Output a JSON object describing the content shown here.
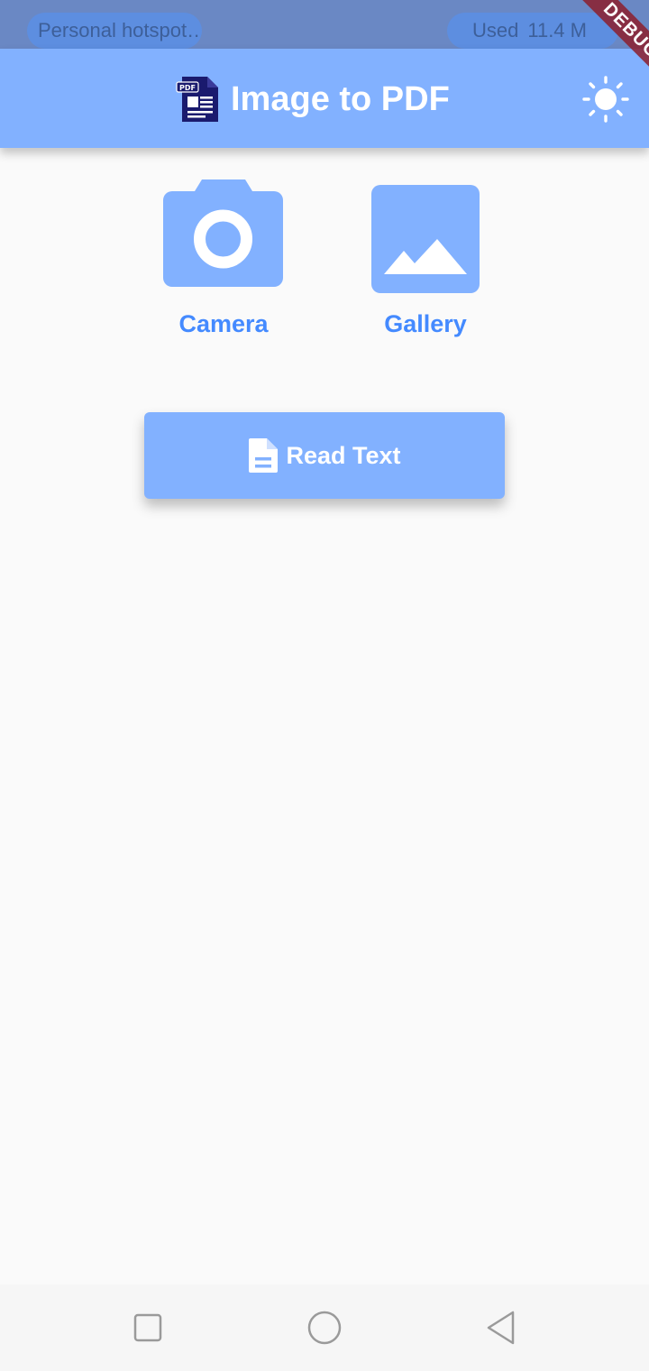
{
  "status_bar": {
    "hotspot_label": "Personal hotspot…",
    "usage_label": "Used",
    "usage_value": "11.4 M"
  },
  "debug_banner": {
    "label": "DEBUG"
  },
  "app_bar": {
    "title": "Image to PDF",
    "logo_icon": "pdf-file-icon",
    "logo_text": "PDF",
    "theme_icon": "sun-icon"
  },
  "sources": {
    "camera": {
      "label": "Camera",
      "icon": "camera-icon"
    },
    "gallery": {
      "label": "Gallery",
      "icon": "image-icon"
    }
  },
  "read_text": {
    "label": "Read Text",
    "icon": "document-icon"
  },
  "nav_bar": {
    "recents_icon": "square-icon",
    "home_icon": "circle-icon",
    "back_icon": "triangle-back-icon"
  },
  "colors": {
    "primary": "#82b1ff",
    "accent_text": "#448aff",
    "logo_navy": "#1a1a6e",
    "background": "#fafafa",
    "status_bar": "#6a88c4"
  }
}
